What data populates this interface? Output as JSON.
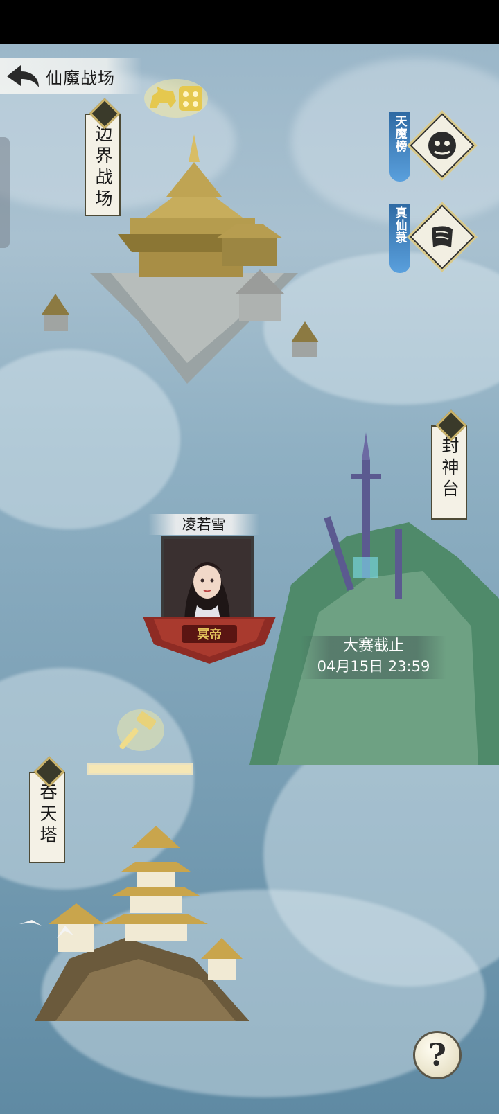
{
  "header": {
    "title": "仙魔战场"
  },
  "map": {
    "border_battlefield_label": "边界战场",
    "fengshen_platform_label": "封神台",
    "tuntian_tower_label": "吞天塔"
  },
  "rankings": {
    "demon_rank_label": "天魔榜",
    "true_immortal_label": "真仙菉"
  },
  "character": {
    "name": "凌若雪",
    "title": "冥帝"
  },
  "event": {
    "deadline_label": "大赛截止",
    "deadline_time": "04月15日 23:59"
  },
  "tower_progress": {
    "fraction": 1.0
  },
  "help": {
    "label": "?"
  },
  "colors": {
    "accent_gold": "#e8d27a",
    "rank_tag_blue": "#3f82c4"
  }
}
